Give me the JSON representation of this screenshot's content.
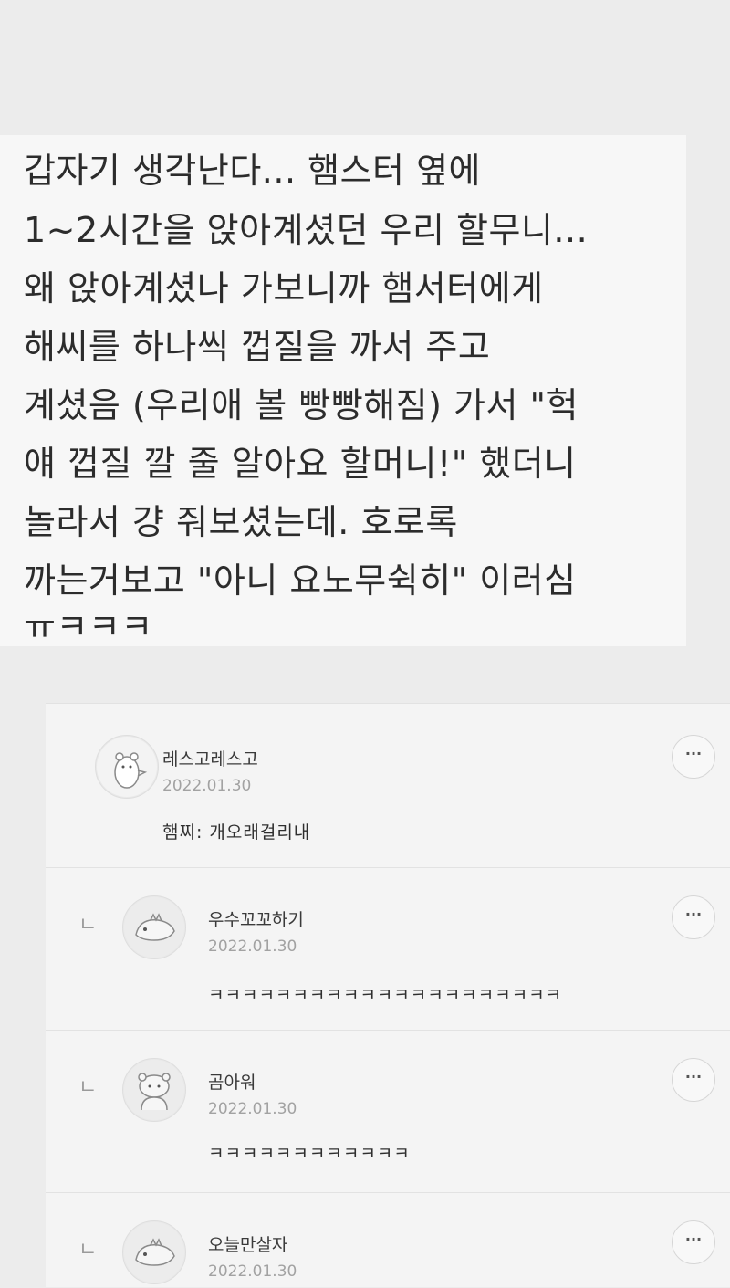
{
  "post": {
    "lines": [
      "갑자기 생각난다... 햄스터 옆에",
      "1~2시간을 앉아계셨던 우리 할무니...",
      "왜 앉아계셨나 가보니까 햄서터에게",
      "해씨를 하나씩 껍질을 까서 주고",
      "계셨음 (우리애 볼 빵빵해짐) 가서 \"헉",
      "얘 껍질 깔 줄 알아요 할머니!\" 했더니",
      "놀라서 걍 줘보셨는데. 호로록",
      "까는거보고 \"아니 요노무쉭히\" 이러심",
      "ㅠㅋㅋㅋ"
    ]
  },
  "comments": [
    {
      "author": "레스고레스고",
      "date": "2022.01.30",
      "text": "햄찌: 개오래걸리내",
      "more": "···",
      "avatar": "bear-avatar-icon"
    },
    {
      "author": "우수꼬꼬하기",
      "date": "2022.01.30",
      "text": "ㅋㅋㅋㅋㅋㅋㅋㅋㅋㅋㅋㅋㅋㅋㅋㅋㅋㅋㅋㅋㅋ",
      "more": "···",
      "reply": "ㄴ",
      "avatar": "dinosaur-avatar-icon"
    },
    {
      "author": "곰아워",
      "date": "2022.01.30",
      "text": "ㅋㅋㅋㅋㅋㅋㅋㅋㅋㅋㅋㅋ",
      "more": "···",
      "reply": "ㄴ",
      "avatar": "bear-face-avatar-icon"
    },
    {
      "author": "오늘만살자",
      "date": "2022.01.30",
      "text": "",
      "more": "···",
      "reply": "ㄴ",
      "avatar": "dinosaur-avatar-icon"
    }
  ]
}
